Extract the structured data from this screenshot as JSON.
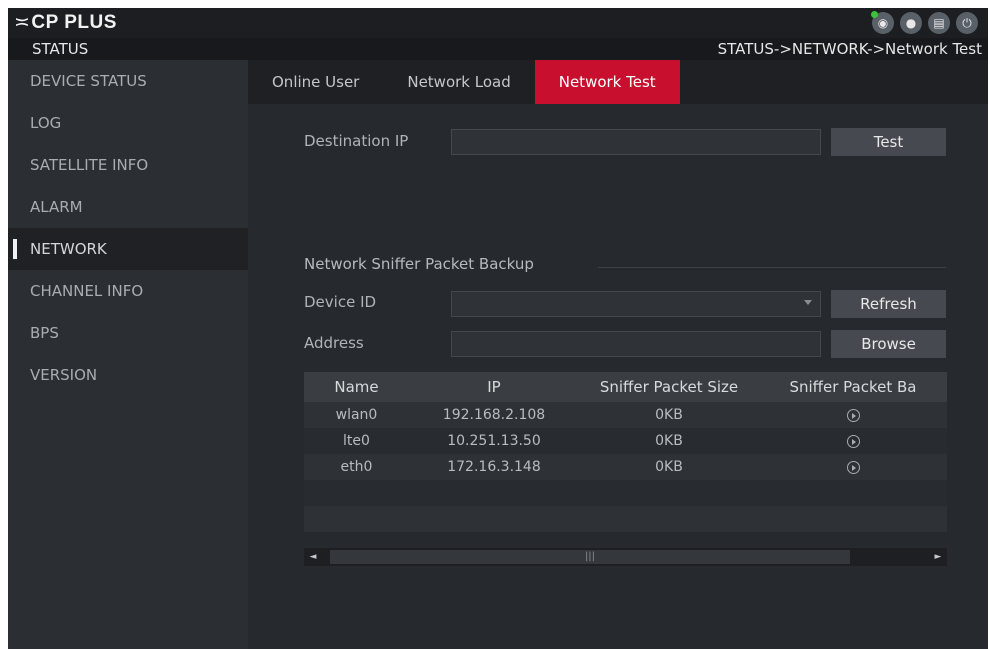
{
  "app": {
    "logo_mark": "≍",
    "logo_text": "CP PLUS",
    "top_icons": [
      "eye-icon",
      "user-icon",
      "menu-grid-icon",
      "power-icon"
    ],
    "top_icon_glyphs": [
      "◉",
      "●",
      "▤",
      "⏻"
    ]
  },
  "header": {
    "section": "STATUS",
    "breadcrumb": "STATUS->NETWORK->Network Test"
  },
  "sidebar": {
    "items": [
      {
        "label": "DEVICE STATUS"
      },
      {
        "label": "LOG"
      },
      {
        "label": "SATELLITE INFO"
      },
      {
        "label": "ALARM"
      },
      {
        "label": "NETWORK"
      },
      {
        "label": "CHANNEL INFO"
      },
      {
        "label": "BPS"
      },
      {
        "label": "VERSION"
      }
    ],
    "active": "NETWORK"
  },
  "tabs": [
    {
      "label": "Online User"
    },
    {
      "label": "Network Load"
    },
    {
      "label": "Network Test"
    }
  ],
  "active_tab": "Network Test",
  "test": {
    "destination_label": "Destination IP",
    "destination_value": "",
    "test_button": "Test"
  },
  "sniffer": {
    "title": "Network Sniffer Packet Backup",
    "device_label": "Device ID",
    "device_value": "",
    "refresh_button": "Refresh",
    "address_label": "Address",
    "address_value": "",
    "browse_button": "Browse",
    "table": {
      "columns": [
        "Name",
        "IP",
        "Sniffer Packet Size",
        "Sniffer Packet Ba"
      ],
      "rows": [
        [
          "wlan0",
          "192.168.2.108",
          "0KB"
        ],
        [
          "lte0",
          "10.251.13.50",
          "0KB"
        ],
        [
          "eth0",
          "172.16.3.148",
          "0KB"
        ]
      ]
    },
    "scroll": {
      "left_arrow": "◄",
      "right_arrow": "►",
      "grip": "|||"
    }
  },
  "colors": {
    "accent": "#c8102e",
    "status_dot": "#3cc23c"
  }
}
